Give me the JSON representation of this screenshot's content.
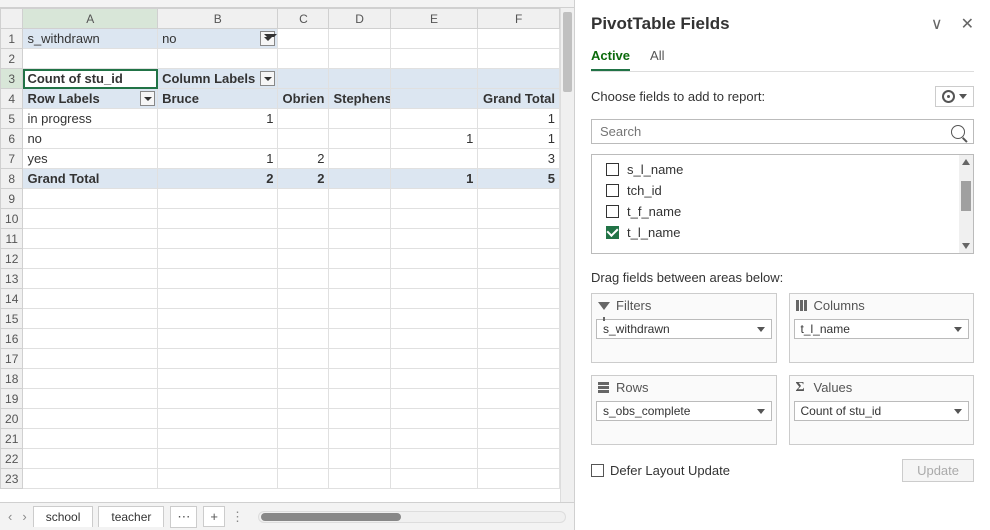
{
  "columns": [
    "A",
    "B",
    "C",
    "D",
    "E",
    "F"
  ],
  "rowCount": 23,
  "activeCell": "A3",
  "pivot": {
    "filterField": "s_withdrawn",
    "filterValue": "no",
    "cornerLabel": "Count of stu_id",
    "columnsLabel": "Column Labels",
    "rowsLabel": "Row Labels",
    "colHeaders": [
      "Bruce",
      "Obrien",
      "Stephens",
      "Grand Total"
    ],
    "dataRows": [
      {
        "label": "in progress",
        "vals": [
          "1",
          "",
          "",
          "1"
        ]
      },
      {
        "label": "no",
        "vals": [
          "",
          "",
          "1",
          "1"
        ]
      },
      {
        "label": "yes",
        "vals": [
          "1",
          "2",
          "",
          "3"
        ]
      }
    ],
    "grandLabel": "Grand Total",
    "grandVals": [
      "2",
      "2",
      "1",
      "5"
    ]
  },
  "sheetTabs": [
    "school",
    "teacher"
  ],
  "pane": {
    "title": "PivotTable Fields",
    "tabs": {
      "active": "Active",
      "all": "All"
    },
    "chooseLabel": "Choose fields to add to report:",
    "searchPlaceholder": "Search",
    "fields": [
      {
        "name": "s_l_name",
        "checked": false
      },
      {
        "name": "tch_id",
        "checked": false
      },
      {
        "name": "t_f_name",
        "checked": false
      },
      {
        "name": "t_l_name",
        "checked": true
      }
    ],
    "dragLabel": "Drag fields between areas below:",
    "areas": {
      "filters": {
        "title": "Filters",
        "chip": "s_withdrawn"
      },
      "columns": {
        "title": "Columns",
        "chip": "t_l_name"
      },
      "rows": {
        "title": "Rows",
        "chip": "s_obs_complete"
      },
      "values": {
        "title": "Values",
        "chip": "Count of stu_id"
      }
    },
    "deferLabel": "Defer Layout Update",
    "updateLabel": "Update"
  }
}
